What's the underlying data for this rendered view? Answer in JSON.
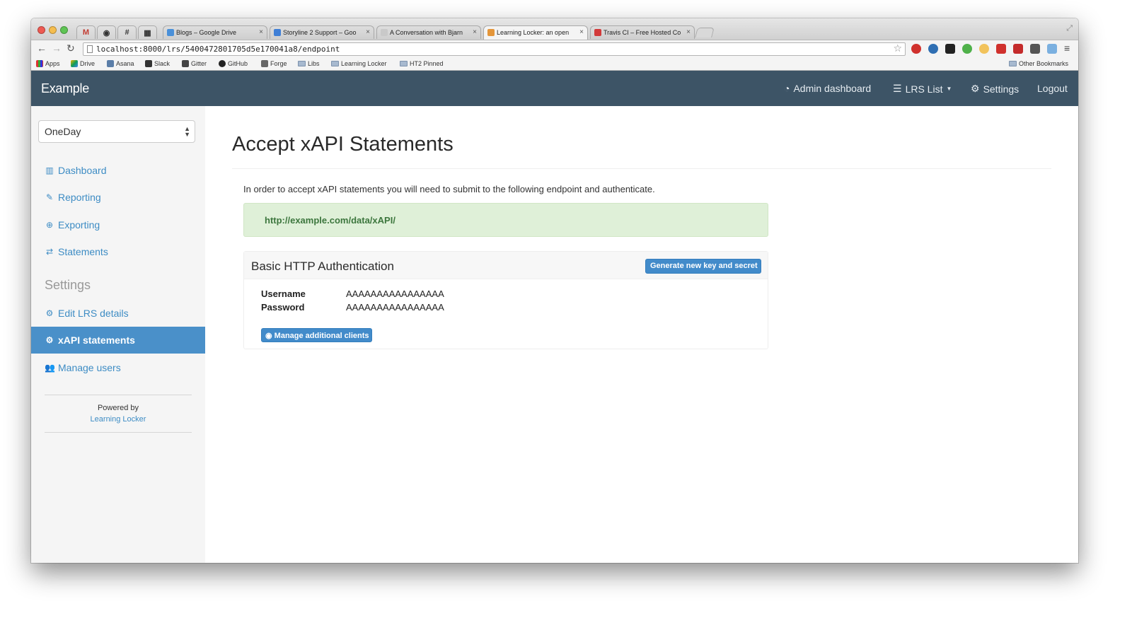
{
  "browser": {
    "pinned_tabs": [
      {
        "icon": "gmail-icon",
        "glyph": "M"
      },
      {
        "icon": "github-icon",
        "glyph": "◉"
      },
      {
        "icon": "slack-icon",
        "glyph": "#"
      },
      {
        "icon": "gitter-icon",
        "glyph": "▦"
      }
    ],
    "tabs": [
      {
        "title": "Blogs – Google Drive",
        "icon": "google-drive-icon",
        "color": "#4a90d9"
      },
      {
        "title": "Storyline 2 Support – Goo",
        "icon": "docs-icon",
        "color": "#3f7fd6"
      },
      {
        "title": "A Conversation with Bjarn",
        "icon": "page-icon",
        "color": "#c9c9c9"
      },
      {
        "title": "Learning Locker: an open",
        "icon": "learning-locker-icon",
        "color": "#e4963a",
        "active": true
      },
      {
        "title": "Travis CI – Free Hosted Co",
        "icon": "travis-icon",
        "color": "#d23a3a"
      }
    ],
    "url": "localhost:8000/lrs/5400472801705d5e170041a8/endpoint",
    "bookmarks": [
      {
        "label": "Apps",
        "icon": "apps-icon"
      },
      {
        "label": "Drive",
        "icon": "google-drive-icon"
      },
      {
        "label": "Asana",
        "icon": "asana-icon"
      },
      {
        "label": "Slack",
        "icon": "slack-icon"
      },
      {
        "label": "Gitter",
        "icon": "gitter-icon"
      },
      {
        "label": "GitHub",
        "icon": "github-icon"
      },
      {
        "label": "Forge",
        "icon": "forge-icon"
      },
      {
        "label": "Libs",
        "icon": "folder-icon"
      },
      {
        "label": "Learning Locker",
        "icon": "folder-icon"
      },
      {
        "label": "HT2 Pinned",
        "icon": "folder-icon"
      }
    ],
    "other_bookmarks": "Other Bookmarks"
  },
  "navbar": {
    "brand": "Example",
    "admin_dashboard": "Admin dashboard",
    "lrs_list": "LRS List",
    "settings": "Settings",
    "logout": "Logout",
    "color": "#3d5466"
  },
  "sidebar": {
    "lrs_select": "OneDay",
    "nav": [
      {
        "label": "Dashboard",
        "icon": "bar-chart-icon"
      },
      {
        "label": "Reporting",
        "icon": "pencil-icon"
      },
      {
        "label": "Exporting",
        "icon": "download-icon"
      },
      {
        "label": "Statements",
        "icon": "exchange-icon"
      }
    ],
    "settings_heading": "Settings",
    "settings_nav": [
      {
        "label": "Edit LRS details",
        "icon": "gear-icon"
      },
      {
        "label": "xAPI statements",
        "icon": "gears-icon",
        "active": true
      },
      {
        "label": "Manage users",
        "icon": "users-icon"
      }
    ],
    "powered_by": "Powered by",
    "powered_link": "Learning Locker",
    "active_color": "#4a90c9",
    "link_color": "#3d8cc4"
  },
  "main": {
    "title": "Accept xAPI Statements",
    "intro": "In order to accept xAPI statements you will need to submit to the following endpoint and authenticate.",
    "endpoint_url": "http://example.com/data/xAPI/",
    "auth": {
      "title": "Basic HTTP Authentication",
      "generate_button": "Generate new key and secret",
      "username_label": "Username",
      "username_value": "AAAAAAAAAAAAAAAA",
      "password_label": "Password",
      "password_value": "AAAAAAAAAAAAAAAA",
      "manage_clients_button": "Manage additional clients"
    }
  }
}
